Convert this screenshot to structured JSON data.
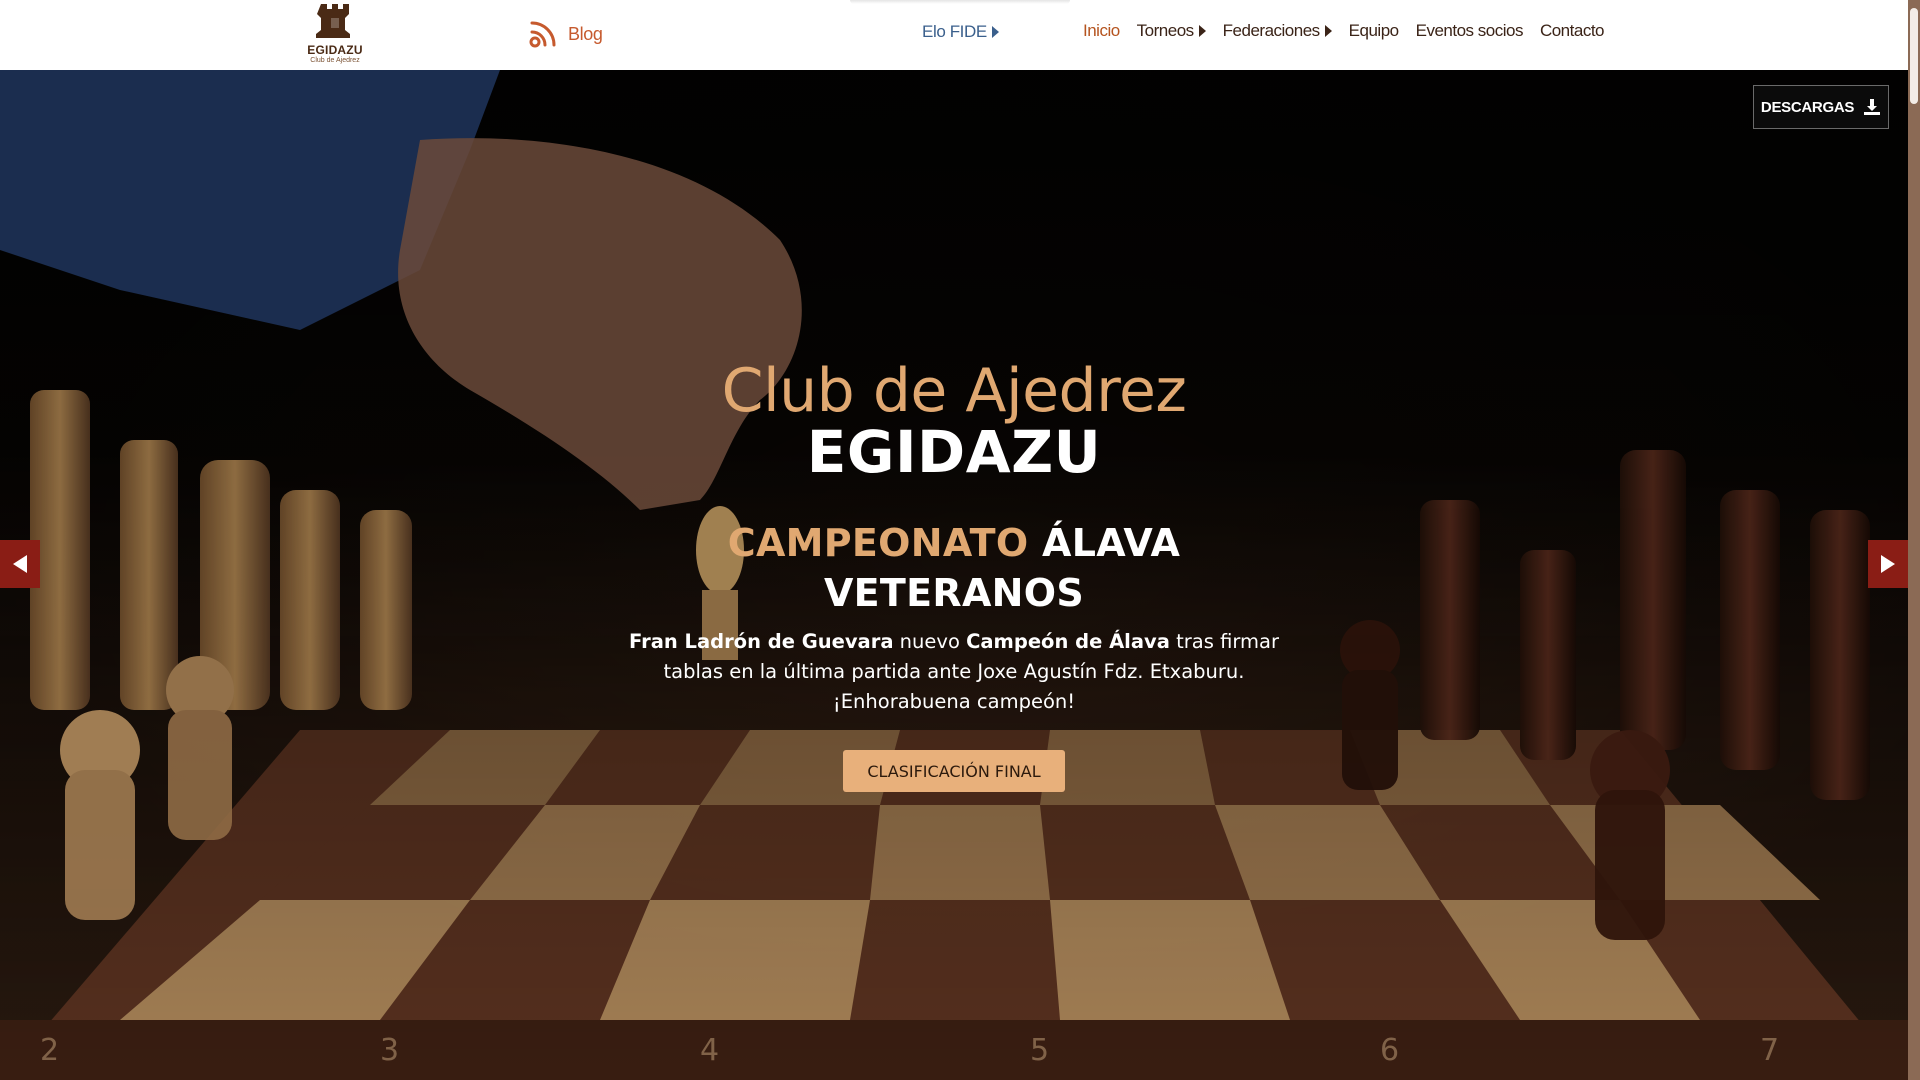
{
  "brand": {
    "name": "EGIDAZU",
    "subtitle": "Club de Ajedrez",
    "logo_icon": "rook-icon"
  },
  "nav": {
    "blog": {
      "label": "Blog",
      "icon": "rss-icon"
    },
    "elo": {
      "label": "Elo FIDE",
      "icon": "caret-right-icon"
    },
    "items": [
      {
        "label": "Inicio",
        "active": true,
        "dropdown": false
      },
      {
        "label": "Torneos",
        "active": false,
        "dropdown": true
      },
      {
        "label": "Federaciones",
        "active": false,
        "dropdown": true
      },
      {
        "label": "Equipo",
        "active": false,
        "dropdown": false
      },
      {
        "label": "Eventos socios",
        "active": false,
        "dropdown": false
      },
      {
        "label": "Contacto",
        "active": false,
        "dropdown": false
      }
    ]
  },
  "downloads": {
    "label": "DESCARGAS",
    "icon": "download-icon"
  },
  "hero": {
    "title_line1": "Club de Ajedrez",
    "title_line2": "EGIDAZU",
    "headline_accent": "CAMPEONATO",
    "headline_rest": "ÁLAVA VETERANOS",
    "paragraph": {
      "bold1": "Fran Ladrón de Guevara",
      "text1": " nuevo ",
      "bold2": "Campeón de Álava",
      "text2": " tras firmar tablas en la última partida ante Joxe Agustín Fdz. Etxaburu. ¡Enhorabuena campeón!"
    },
    "cta_label": "CLASIFICACIÓN FINAL",
    "board_numbers": [
      "2",
      "3",
      "4",
      "5",
      "6",
      "7"
    ],
    "prev_icon": "prev-arrow-icon",
    "next_icon": "next-arrow-icon"
  },
  "colors": {
    "accent_gold": "#e0a871",
    "active_link": "#b5541f",
    "blog_orange": "#c65a2e",
    "arrow_red": "#8a1d15",
    "cta_bg": "#e8b07b"
  }
}
